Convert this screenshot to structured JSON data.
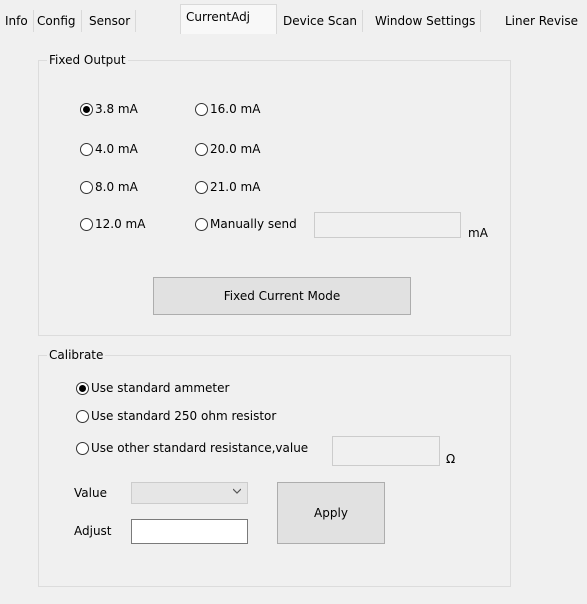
{
  "tabs": [
    {
      "label": "Info"
    },
    {
      "label": "Config"
    },
    {
      "label": "Sensor"
    },
    {
      "label": "CurrentAdj",
      "active": true
    },
    {
      "label": "Device Scan"
    },
    {
      "label": "Window Settings"
    },
    {
      "label": "Liner Revise"
    }
  ],
  "fixed_output": {
    "title": "Fixed Output",
    "options": [
      "3.8 mA",
      "4.0 mA",
      "8.0 mA",
      "12.0 mA",
      "16.0 mA",
      "20.0 mA",
      "21.0 mA",
      "Manually send"
    ],
    "selected": "3.8 mA",
    "manual_value": "",
    "unit": "mA",
    "button_label": "Fixed Current Mode"
  },
  "calibrate": {
    "title": "Calibrate",
    "options": [
      "Use standard ammeter",
      "Use standard 250 ohm resistor",
      "Use other standard resistance,value"
    ],
    "selected": "Use standard ammeter",
    "resistance_value": "",
    "resistance_unit": "Ω",
    "value_label": "Value",
    "value_selected": "",
    "adjust_label": "Adjust",
    "adjust_value": "",
    "apply_label": "Apply"
  },
  "icons": {
    "dropdown": "chevron-down-icon",
    "radio": "radio-button-icon"
  }
}
